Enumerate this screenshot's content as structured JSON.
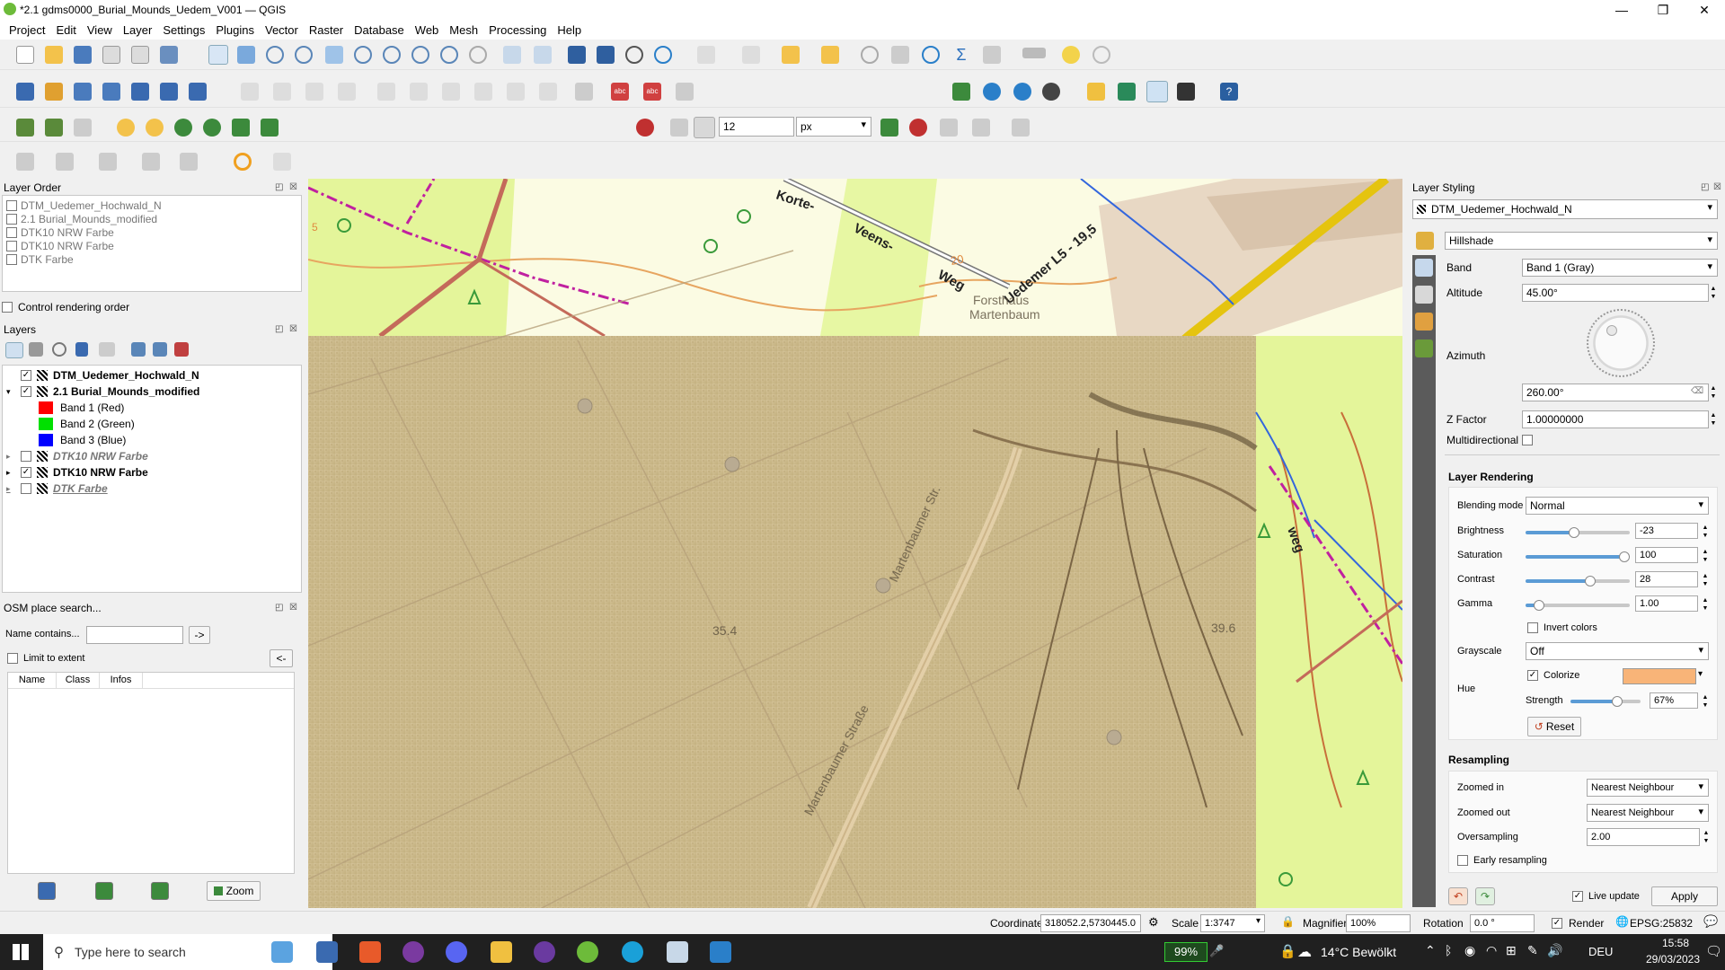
{
  "window": {
    "title": "*2.1 gdms0000_Burial_Mounds_Uedem_V001 — QGIS",
    "minimize": "—",
    "maximize": "❐",
    "close": "✕"
  },
  "menu": [
    "Project",
    "Edit",
    "View",
    "Layer",
    "Settings",
    "Plugins",
    "Vector",
    "Raster",
    "Database",
    "Web",
    "Mesh",
    "Processing",
    "Help"
  ],
  "toolbar": {
    "snap_tolerance": "12",
    "snap_unit": "px"
  },
  "layer_order": {
    "title": "Layer Order",
    "items": [
      "DTM_Uedemer_Hochwald_N",
      "2.1 Burial_Mounds_modified",
      "DTK10 NRW Farbe",
      "DTK10 NRW Farbe",
      "DTK Farbe"
    ],
    "control_label": "Control rendering order"
  },
  "layers": {
    "title": "Layers",
    "items": [
      {
        "name": "DTM_Uedemer_Hochwald_N",
        "checked": "✓",
        "bold": true
      },
      {
        "name": "2.1 Burial_Mounds_modified",
        "checked": "✓",
        "bold": true
      },
      {
        "name": "Band 1 (Red)",
        "color": "#ff0000"
      },
      {
        "name": "Band 2 (Green)",
        "color": "#00e000"
      },
      {
        "name": "Band 3 (Blue)",
        "color": "#0000ff"
      },
      {
        "name": "DTK10 NRW Farbe",
        "checked": ""
      },
      {
        "name": "DTK10 NRW Farbe",
        "checked": "✓",
        "bold": true
      },
      {
        "name": "DTK Farbe",
        "checked": ""
      }
    ]
  },
  "osm": {
    "title": "OSM place search...",
    "name_label": "Name contains...",
    "go": "->",
    "limit_label": "Limit to extent",
    "back": "<-",
    "columns": [
      "Name",
      "Class",
      "Infos"
    ],
    "zoom": "Zoom"
  },
  "map": {
    "labels": [
      "Korte-",
      "Veens-",
      "Weg",
      "Uedemer L5 - 19,5",
      "Forsthaus",
      "Martenbaum",
      "Martenbaumer Str.",
      "Martenbaumer Straße",
      "weg",
      "20",
      "35.4",
      "39.6",
      "5"
    ]
  },
  "styling": {
    "title": "Layer Styling",
    "layer": "DTM_Uedemer_Hochwald_N",
    "renderer": "Hillshade",
    "band_label": "Band",
    "band": "Band 1 (Gray)",
    "altitude_label": "Altitude",
    "altitude": "45.00°",
    "azimuth_label": "Azimuth",
    "azimuth": "260.00°",
    "zfactor_label": "Z Factor",
    "zfactor": "1.00000000",
    "multidirectional_label": "Multidirectional",
    "rendering_title": "Layer Rendering",
    "blending_label": "Blending mode",
    "blending": "Normal",
    "brightness_label": "Brightness",
    "brightness": "-23",
    "saturation_label": "Saturation",
    "saturation": "100",
    "contrast_label": "Contrast",
    "contrast": "28",
    "gamma_label": "Gamma",
    "gamma": "1.00",
    "invert_label": "Invert colors",
    "grayscale_label": "Grayscale",
    "grayscale": "Off",
    "hue_label": "Hue",
    "colorize_label": "Colorize",
    "colorize_color": "#f8b478",
    "strength_label": "Strength",
    "strength": "67%",
    "reset": "Reset",
    "resampling_title": "Resampling",
    "zoomed_in_label": "Zoomed in",
    "zoomed_in": "Nearest Neighbour",
    "zoomed_out_label": "Zoomed out",
    "zoomed_out": "Nearest Neighbour",
    "oversampling_label": "Oversampling",
    "oversampling": "2.00",
    "early_label": "Early resampling",
    "live_label": "Live update",
    "apply": "Apply"
  },
  "status": {
    "coordinate_label": "Coordinate",
    "coordinate": "318052.2,5730445.0",
    "scale_label": "Scale",
    "scale": "1:3747",
    "magnifier_label": "Magnifier",
    "magnifier": "100%",
    "rotation_label": "Rotation",
    "rotation": "0.0 °",
    "render_label": "Render",
    "crs": "EPSG:25832"
  },
  "taskbar": {
    "search": "Type here to search",
    "battery": "99%",
    "weather": "14°C  Bewölkt",
    "lang": "DEU",
    "time": "15:58",
    "date": "29/03/2023"
  }
}
